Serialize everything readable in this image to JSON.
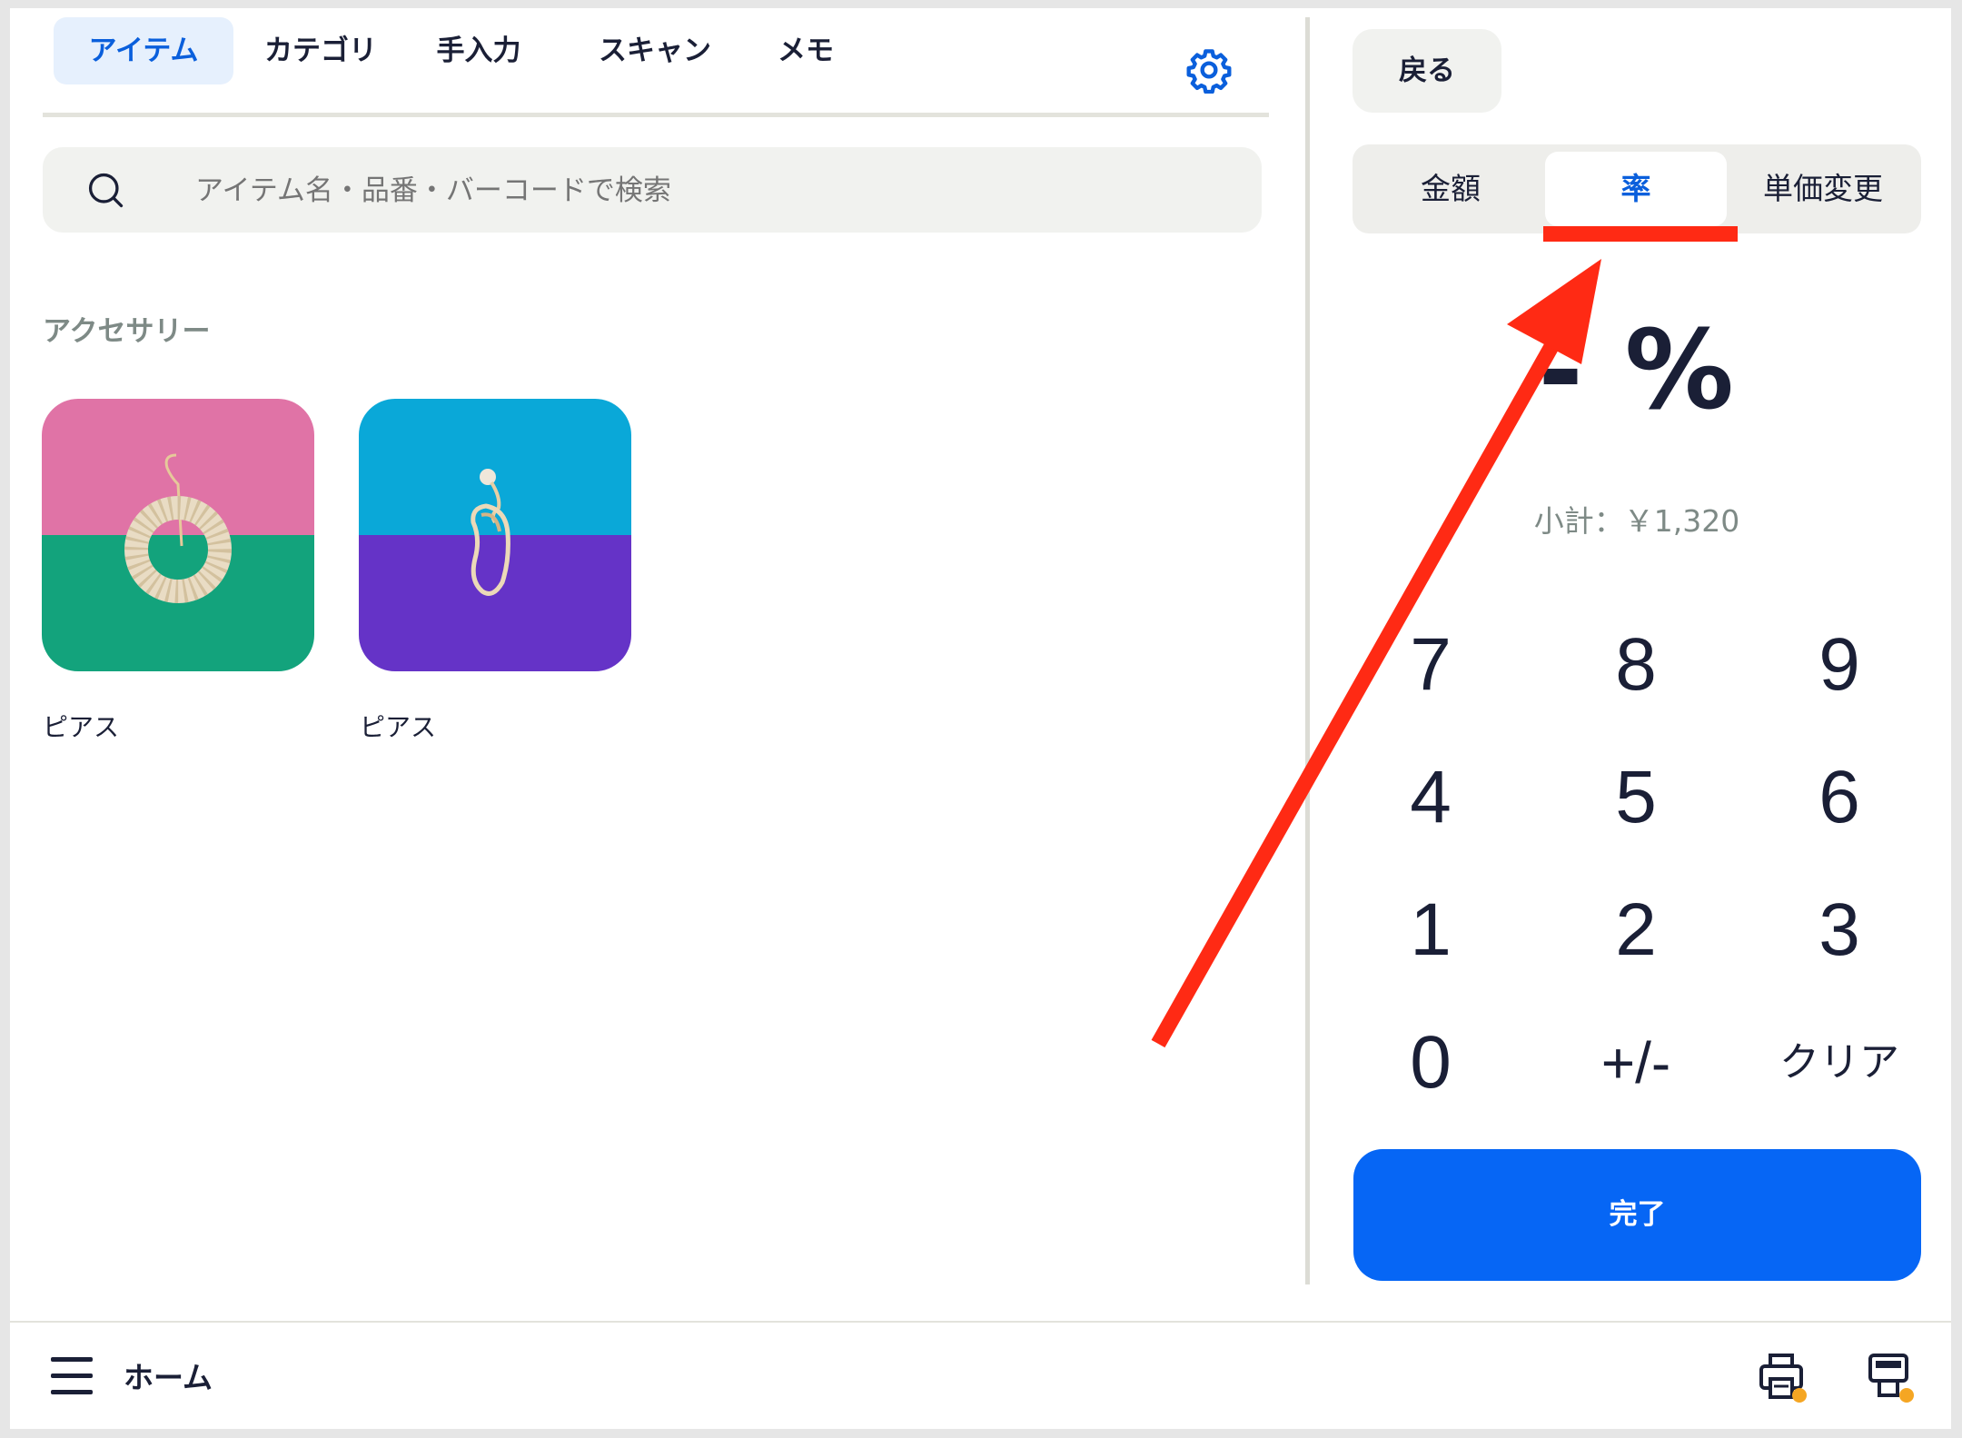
{
  "tabs": [
    {
      "label": "アイテム",
      "active": true
    },
    {
      "label": "カテゴリ",
      "active": false
    },
    {
      "label": "手入力",
      "active": false
    },
    {
      "label": "スキャン",
      "active": false
    },
    {
      "label": "メモ",
      "active": false
    }
  ],
  "search": {
    "placeholder": "アイテム名・品番・バーコードで検索"
  },
  "section": {
    "title": "アクセサリー"
  },
  "items": [
    {
      "label": "ピアス",
      "colors": {
        "top": "#e073a6",
        "bottom": "#13a37c"
      }
    },
    {
      "label": "ピアス",
      "colors": {
        "top": "#0aa8d8",
        "bottom": "#6533c7"
      }
    }
  ],
  "right": {
    "back_label": "戻る",
    "segments": [
      {
        "label": "金額",
        "active": false
      },
      {
        "label": "率",
        "active": true
      },
      {
        "label": "単価変更",
        "active": false
      }
    ],
    "rate_display": "- %",
    "subtotal": "小計：￥1,320",
    "keypad": [
      "7",
      "8",
      "9",
      "4",
      "5",
      "6",
      "1",
      "2",
      "3",
      "0",
      "+/-",
      "クリア"
    ],
    "done_label": "完了"
  },
  "bottom": {
    "title": "ホーム"
  },
  "colors": {
    "accent": "#0666f5",
    "annotation": "#ff2a14",
    "badge": "#f5a623"
  }
}
